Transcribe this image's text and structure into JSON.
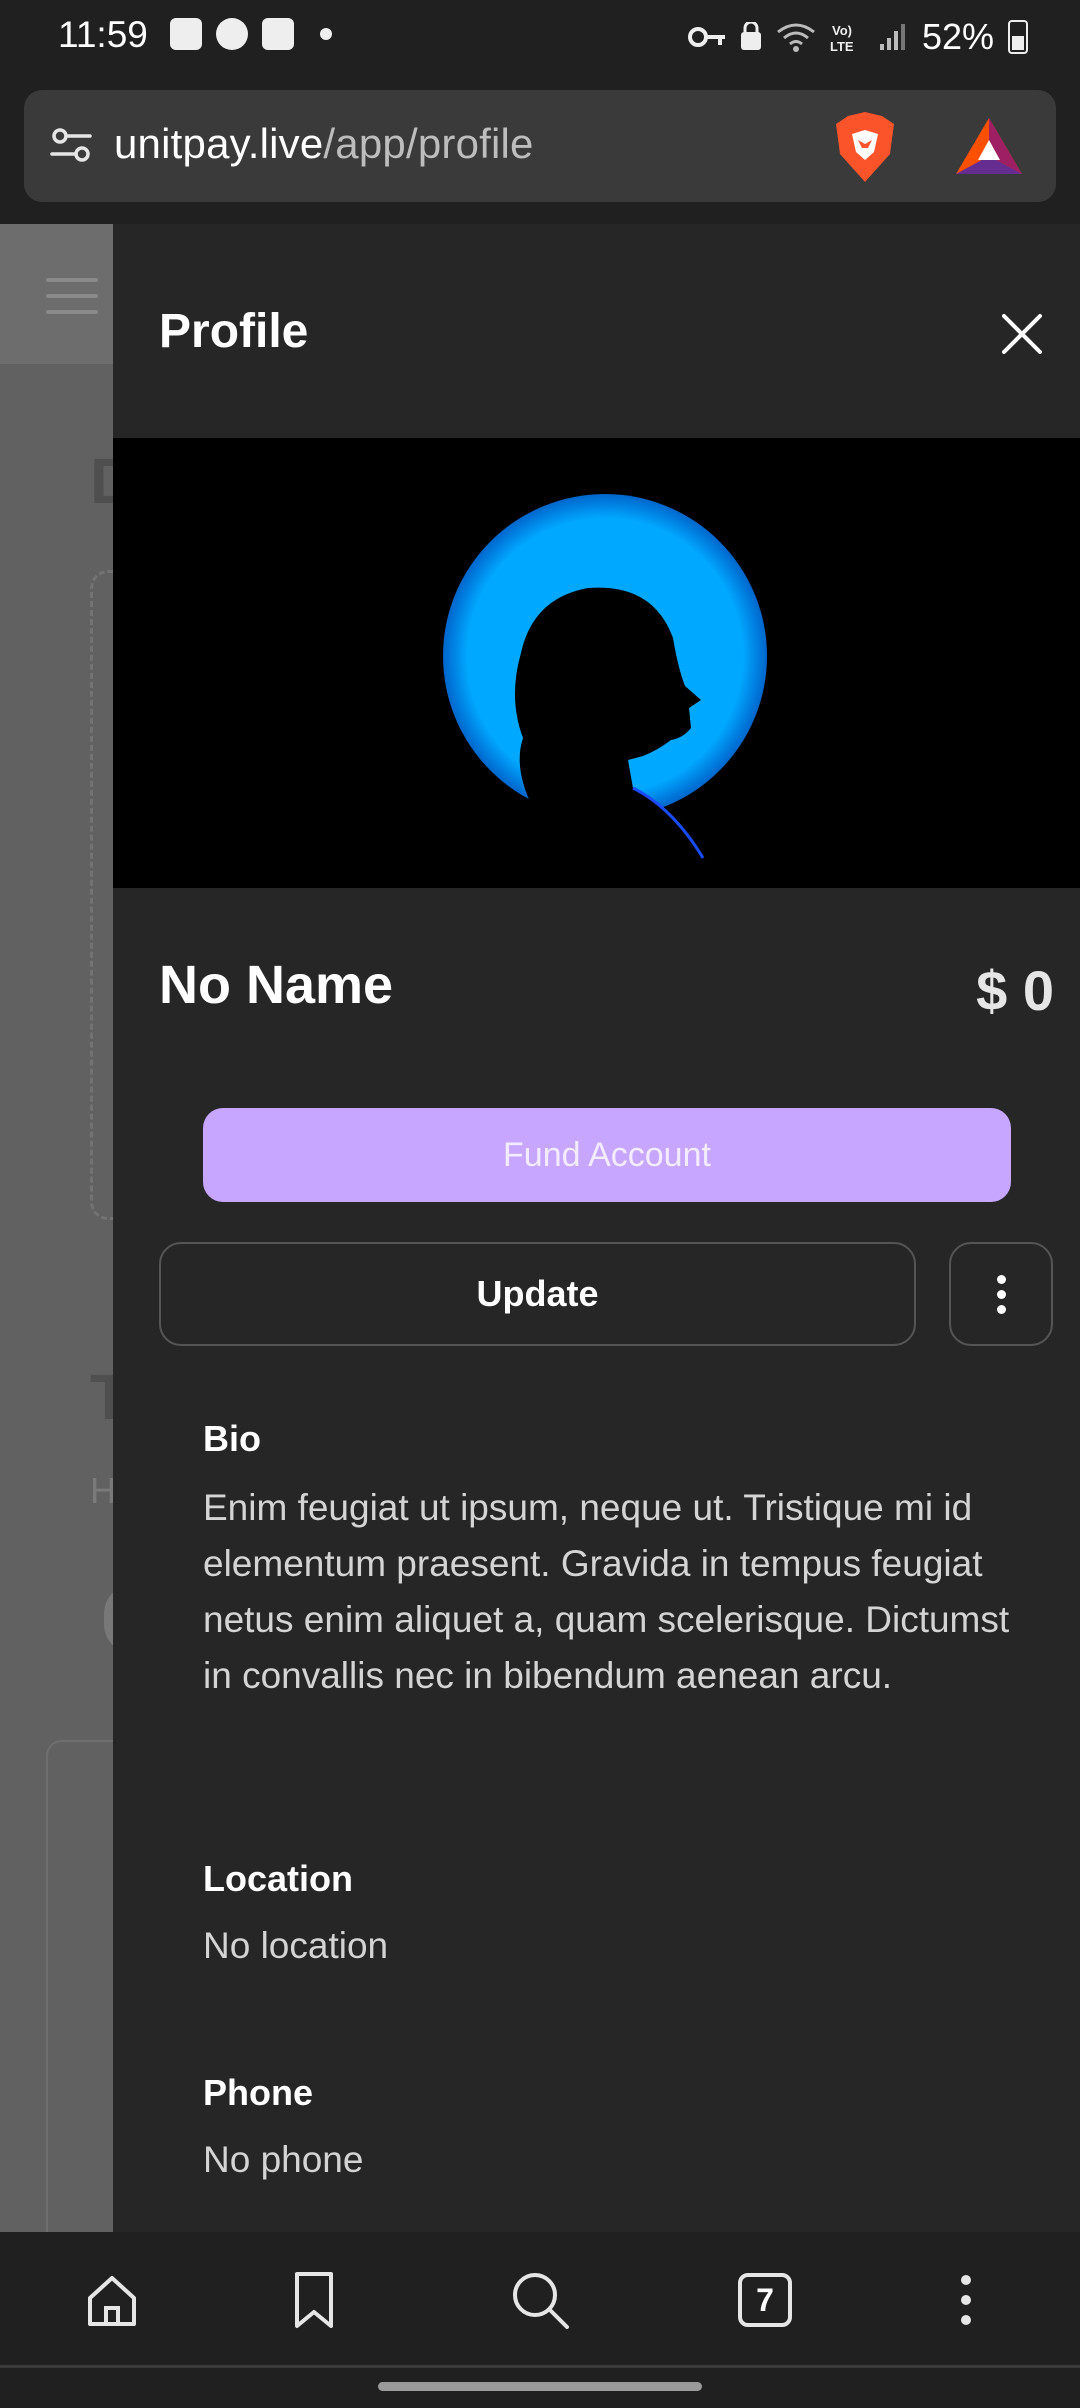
{
  "status_bar": {
    "time": "11:59",
    "battery": "52%"
  },
  "browser": {
    "url_domain": "unitpay.live",
    "url_path": "/app/profile",
    "tab_count": "7"
  },
  "drawer": {
    "title": "Profile",
    "name": "No Name",
    "balance": "$ 0",
    "fund_label": "Fund Account",
    "update_label": "Update",
    "sections": [
      {
        "label": "Bio",
        "value": "Enim feugiat ut ipsum, neque ut. Tristique mi id elementum praesent. Gravida in tempus feugiat netus enim aliquet a, quam scelerisque. Dictumst in convallis nec in bibendum aenean arcu."
      },
      {
        "label": "Location",
        "value": "No location"
      },
      {
        "label": "Phone",
        "value": "No phone"
      }
    ]
  },
  "colors": {
    "accent": "#c7a6ff",
    "hero_glow": "#00a8ff",
    "drawer_bg": "#262626"
  }
}
